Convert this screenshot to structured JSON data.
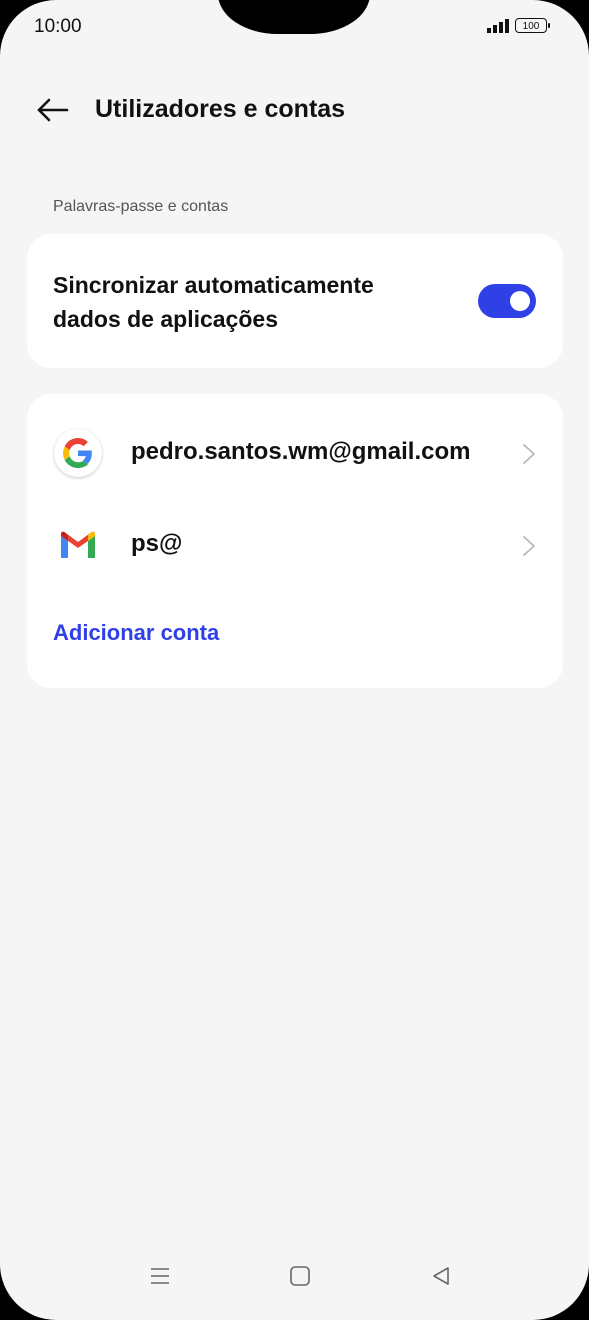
{
  "status_bar": {
    "time": "10:00",
    "battery": "100"
  },
  "header": {
    "title": "Utilizadores e contas",
    "back_icon": "arrow-left-icon"
  },
  "section": {
    "label": "Palavras-passe e contas"
  },
  "sync": {
    "label": "Sincronizar automaticamente dados de aplicações",
    "enabled": true,
    "accent": "#2f40e6"
  },
  "accounts": [
    {
      "icon": "google-icon",
      "label": "pedro.santos.wm@gmail.com"
    },
    {
      "icon": "gmail-icon",
      "label": "ps@"
    }
  ],
  "add_account": {
    "label": "Adicionar conta"
  },
  "nav": {
    "menu_icon": "menu-icon",
    "home_icon": "home-icon",
    "back_icon": "back-triangle-icon"
  }
}
